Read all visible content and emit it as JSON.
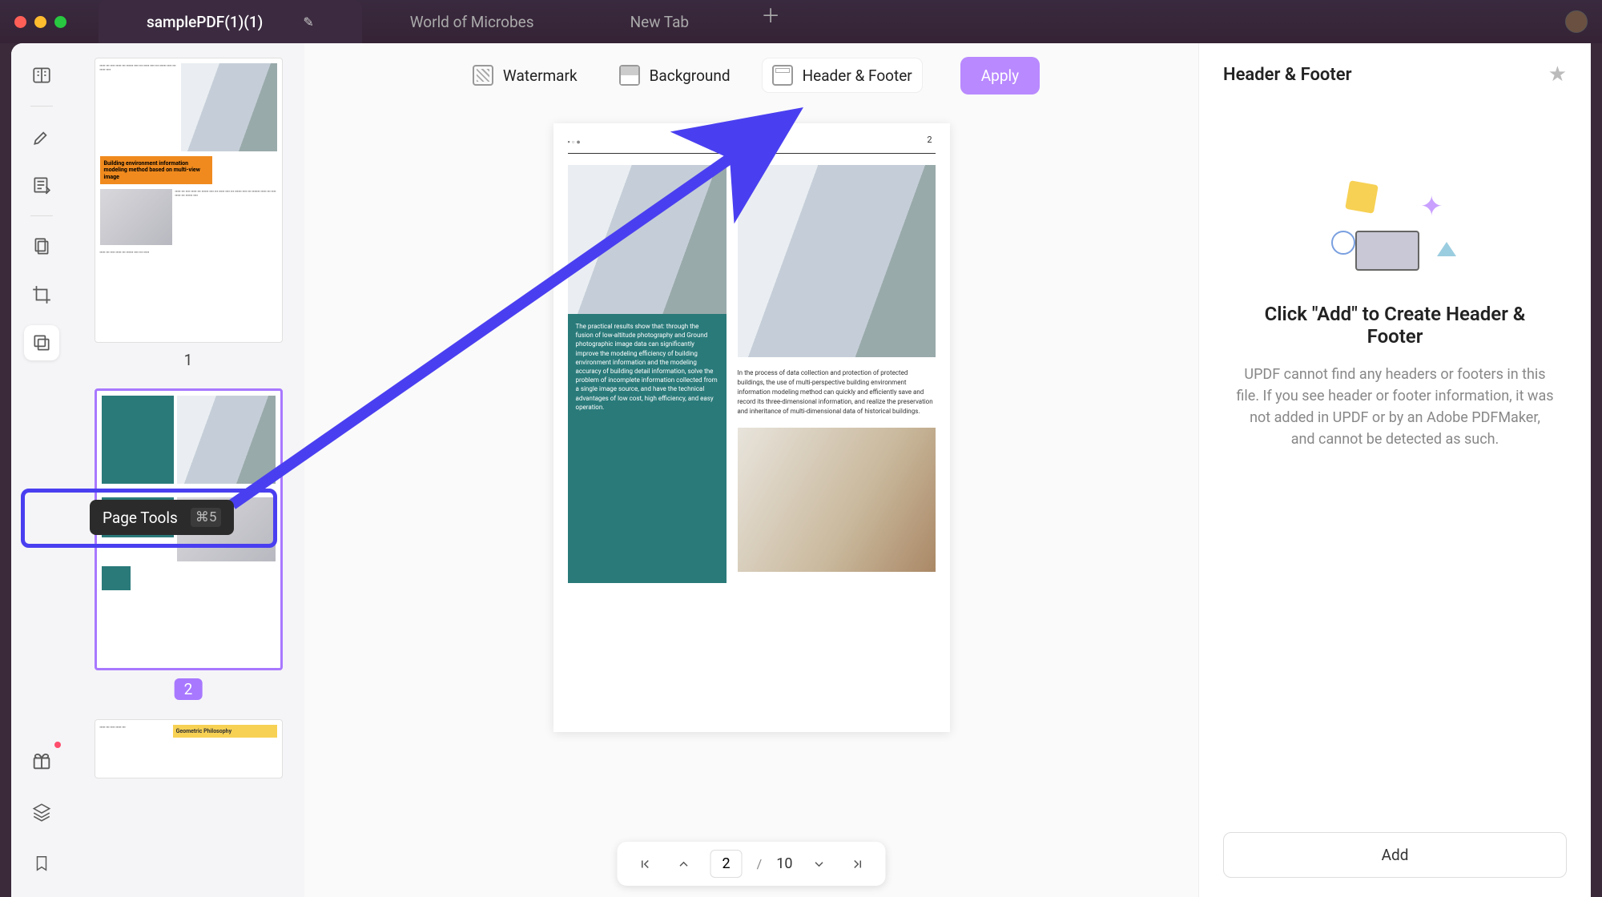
{
  "titlebar": {
    "tabs": [
      {
        "label": "samplePDF(1)(1)",
        "active": true
      },
      {
        "label": "World of Microbes",
        "active": false
      },
      {
        "label": "New Tab",
        "active": false
      }
    ]
  },
  "leftrail": {
    "tooltip_label": "Page Tools",
    "tooltip_shortcut": "⌘5"
  },
  "toolbar": {
    "watermark": "Watermark",
    "background": "Background",
    "header_footer": "Header & Footer",
    "apply": "Apply"
  },
  "pager": {
    "current": "2",
    "total": "10",
    "sep": "/"
  },
  "page_preview": {
    "page_number": "2",
    "teal_text": "The practical results show that: through the fusion of low-altitude photography and Ground photographic image data can significantly improve the modeling efficiency of building environment information and the modeling accuracy of building detail information, solve the problem of incomplete information collected from a single image source, and have the technical advantages of low cost, high efficiency, and easy operation.",
    "body_text": "In the process of data collection and protection of protected buildings, the use of multi-perspective building environment information modeling method can quickly and efficiently save and record its three-dimensional information, and realize the preservation and inheritance of multi-dimensional data of historical buildings."
  },
  "thumbs": {
    "page1_label": "1",
    "page2_label": "2",
    "page1_title": "Building environment information modeling method based on multi-view image",
    "page3_title": "Geometric Philosophy"
  },
  "right_panel": {
    "title": "Header & Footer",
    "empty_title": "Click \"Add\" to Create Header & Footer",
    "empty_desc": "UPDF cannot find any headers or footers in this file. If you see header or footer information, it was not added in UPDF or by an Adobe PDFMaker, and cannot be detected as such.",
    "add": "Add"
  }
}
